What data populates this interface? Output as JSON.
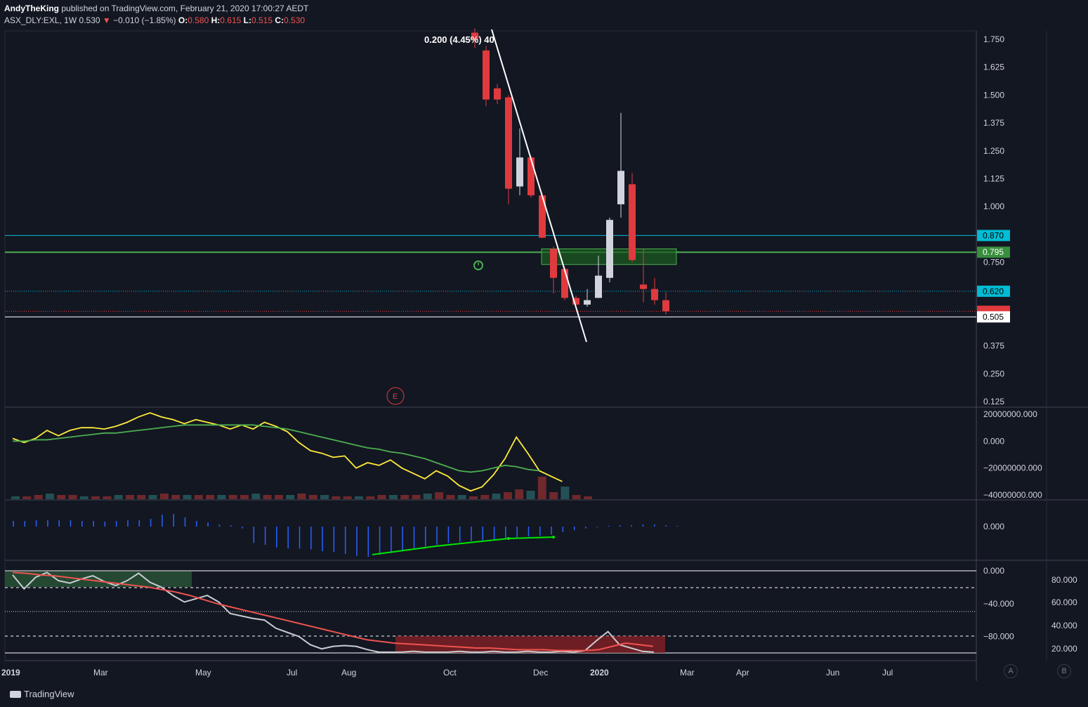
{
  "header": {
    "author": "AndyTheKing",
    "published": "published on TradingView.com, February 21, 2020 17:00:27 AEDT",
    "symbol": "ASX_DLY:EXL, 1W",
    "last": "0.530",
    "change": "−0.010 (−1.85%)",
    "o_label": "O:",
    "o": "0.580",
    "h_label": "H:",
    "h": "0.615",
    "l_label": "L:",
    "l": "0.515",
    "c_label": "C:",
    "c": "0.530"
  },
  "footer": {
    "brand": "TradingView",
    "btn_a": "A",
    "btn_b": "B"
  },
  "colors": {
    "bg": "#131722",
    "grid": "#2a2e39",
    "up": "#d1d4dc",
    "down": "#e03a3e",
    "cyan": "#00bcd4",
    "green": "#4caf50",
    "yellow": "#ffeb3b",
    "blue": "#2962ff"
  },
  "chart_data": [
    {
      "type": "candlestick",
      "price_ticks": [
        "1.750",
        "1.625",
        "1.500",
        "1.375",
        "1.250",
        "1.125",
        "1.000",
        "0.750",
        "0.375",
        "0.250",
        "0.125"
      ],
      "price_labels": {
        "l870": "0.870",
        "l795": "0.795",
        "l620": "0.620",
        "l505": "0.505"
      },
      "x_labels": [
        "2019",
        "Mar",
        "May",
        "Jul",
        "Aug",
        "Oct",
        "Dec",
        "2020",
        "Mar",
        "Apr",
        "Jun",
        "Jul"
      ],
      "annotation": "0.200 (4.45%) 40",
      "event_marker": "E",
      "candles": [
        {
          "o": 1.78,
          "h": 1.8,
          "l": 1.71,
          "c": 1.75
        },
        {
          "o": 1.7,
          "h": 1.72,
          "l": 1.45,
          "c": 1.48
        },
        {
          "o": 1.53,
          "h": 1.55,
          "l": 1.46,
          "c": 1.48
        },
        {
          "o": 1.49,
          "h": 1.5,
          "l": 1.01,
          "c": 1.08
        },
        {
          "o": 1.09,
          "h": 1.35,
          "l": 1.05,
          "c": 1.22
        },
        {
          "o": 1.22,
          "h": 1.23,
          "l": 1.04,
          "c": 1.05
        },
        {
          "o": 1.05,
          "h": 1.06,
          "l": 0.86,
          "c": 0.86
        },
        {
          "o": 0.81,
          "h": 0.82,
          "l": 0.61,
          "c": 0.68
        },
        {
          "o": 0.72,
          "h": 0.73,
          "l": 0.58,
          "c": 0.59
        },
        {
          "o": 0.59,
          "h": 0.6,
          "l": 0.54,
          "c": 0.56
        },
        {
          "o": 0.56,
          "h": 0.63,
          "l": 0.55,
          "c": 0.58
        },
        {
          "o": 0.59,
          "h": 0.78,
          "l": 0.59,
          "c": 0.69
        },
        {
          "o": 0.68,
          "h": 0.95,
          "l": 0.66,
          "c": 0.94
        },
        {
          "o": 1.01,
          "h": 1.42,
          "l": 0.95,
          "c": 1.16
        },
        {
          "o": 1.1,
          "h": 1.15,
          "l": 0.75,
          "c": 0.76
        },
        {
          "o": 0.65,
          "h": 0.81,
          "l": 0.57,
          "c": 0.63
        },
        {
          "o": 0.63,
          "h": 0.68,
          "l": 0.56,
          "c": 0.58
        },
        {
          "o": 0.58,
          "h": 0.615,
          "l": 0.515,
          "c": 0.53
        }
      ]
    },
    {
      "type": "line",
      "y_ticks": [
        "20000000.000",
        "0.000",
        "−20000000.000",
        "−40000000.000"
      ],
      "series": [
        {
          "color": "#ffeb3b",
          "values": [
            2,
            -1,
            2,
            8,
            4,
            8,
            10,
            10,
            9,
            11,
            14,
            18,
            21,
            18,
            16,
            13,
            16,
            14,
            12,
            9,
            12,
            9,
            14,
            11,
            7,
            -1,
            -7,
            -9,
            -12,
            -11,
            -20,
            -16,
            -18,
            -14,
            -20,
            -24,
            -28,
            -22,
            -26,
            -33,
            -37,
            -34,
            -25,
            -13,
            3,
            -9,
            -22,
            -26,
            -30
          ]
        },
        {
          "color": "#4caf50",
          "values": [
            0,
            0,
            1,
            1,
            2,
            3,
            4,
            5,
            6,
            6,
            7,
            8,
            9,
            10,
            11,
            12,
            12,
            12,
            12,
            12,
            12,
            12,
            11,
            10,
            9,
            7,
            5,
            3,
            1,
            -1,
            -3,
            -5,
            -6,
            -8,
            -9,
            -11,
            -13,
            -16,
            -19,
            -22,
            -23,
            -22,
            -20,
            -18,
            -19,
            -21,
            -22
          ]
        }
      ],
      "bars": [
        2,
        2,
        3,
        4,
        3,
        3,
        2,
        2,
        2,
        3,
        3,
        3,
        3,
        4,
        3,
        3,
        3,
        3,
        3,
        3,
        3,
        4,
        3,
        3,
        3,
        4,
        3,
        3,
        2,
        2,
        2,
        2,
        3,
        3,
        3,
        3,
        4,
        5,
        3,
        3,
        2,
        3,
        4,
        5,
        7,
        6,
        16,
        5,
        9,
        3,
        2
      ]
    },
    {
      "type": "bar",
      "y_ticks": [
        "0.000"
      ],
      "values": [
        8,
        8,
        9,
        9,
        9,
        9,
        8,
        8,
        7,
        8,
        9,
        9,
        11,
        17,
        18,
        13,
        8,
        6,
        3,
        2,
        -2,
        -18,
        -20,
        -23,
        -24,
        -24,
        -25,
        -27,
        -28,
        -30,
        -32,
        -33,
        -31,
        -29,
        -27,
        -25,
        -22,
        -20,
        -18,
        -17,
        -16,
        -15,
        -14,
        -13,
        -12,
        -11,
        -10,
        -9,
        -6,
        -4,
        -2,
        -1,
        1,
        2,
        2,
        3,
        3,
        2,
        1
      ]
    },
    {
      "type": "line",
      "y_ticks_left": [
        "0.000",
        "−40.000",
        "−80.000"
      ],
      "y_ticks_right": [
        "80.000",
        "60.000",
        "40.000",
        "20.000"
      ],
      "series": [
        {
          "color": "#c8ccd0",
          "values": [
            -5,
            -22,
            -8,
            -2,
            -12,
            -15,
            -10,
            -6,
            -13,
            -18,
            -12,
            -3,
            -14,
            -20,
            -30,
            -38,
            -34,
            -30,
            -38,
            -52,
            -55,
            -58,
            -60,
            -70,
            -75,
            -80,
            -90,
            -95,
            -92,
            -91,
            -92,
            -96,
            -99,
            -99,
            -99,
            -98,
            -99,
            -99,
            -99,
            -98,
            -99,
            -99,
            -98,
            -99,
            -99,
            -98,
            -99,
            -99,
            -98,
            -99,
            -97,
            -85,
            -74,
            -90,
            -94,
            -98,
            -99
          ]
        },
        {
          "color": "#ef5350",
          "values": [
            -2,
            -3,
            -5,
            -6,
            -8,
            -10,
            -12,
            -14,
            -16,
            -18,
            -20,
            -23,
            -26,
            -30,
            -35,
            -40,
            -44,
            -48,
            -52,
            -56,
            -60,
            -64,
            -68,
            -72,
            -76,
            -80,
            -84,
            -86,
            -88,
            -89,
            -90,
            -91,
            -92,
            -93,
            -94,
            -94,
            -95,
            -96,
            -96,
            -96,
            -97,
            -97,
            -97,
            -96,
            -92,
            -88,
            -90,
            -92
          ]
        }
      ]
    }
  ]
}
